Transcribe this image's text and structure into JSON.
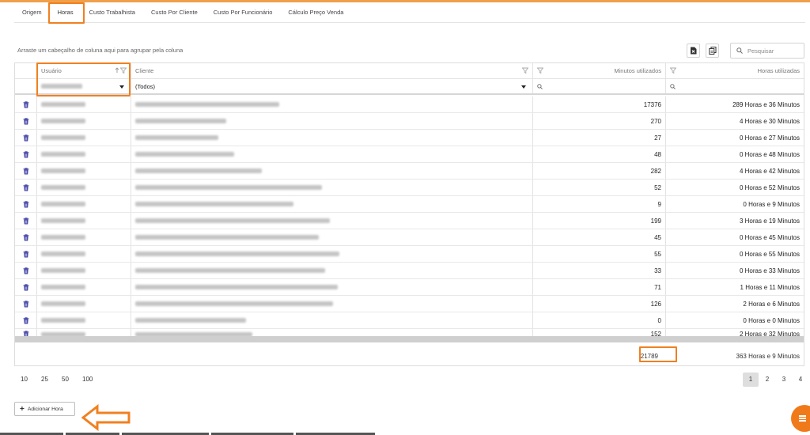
{
  "tabs": [
    {
      "label": "Origem"
    },
    {
      "label": "Horas",
      "active": true
    },
    {
      "label": "Custo Trabalhista"
    },
    {
      "label": "Custo Por Cliente"
    },
    {
      "label": "Custo Por Funcionário"
    },
    {
      "label": "Cálculo Preço Venda"
    }
  ],
  "grid": {
    "group_hint": "Arraste um cabeçalho de coluna aqui para agrupar pela coluna",
    "search_placeholder": "Pesquisar",
    "columns": {
      "usuario": "Usuário",
      "cliente": "Cliente",
      "minutos": "Minutos utilizados",
      "horas": "Horas utilizadas"
    },
    "filters": {
      "cliente": "(Todos)"
    },
    "rows": [
      {
        "minutos": "17376",
        "horas": "289 Horas e 36 Minutos"
      },
      {
        "minutos": "270",
        "horas": "4 Horas e 30 Minutos"
      },
      {
        "minutos": "27",
        "horas": "0 Horas e 27 Minutos"
      },
      {
        "minutos": "48",
        "horas": "0 Horas e 48 Minutos"
      },
      {
        "minutos": "282",
        "horas": "4 Horas e 42 Minutos"
      },
      {
        "minutos": "52",
        "horas": "0 Horas e 52 Minutos"
      },
      {
        "minutos": "9",
        "horas": "0 Horas e 9 Minutos"
      },
      {
        "minutos": "199",
        "horas": "3 Horas e 19 Minutos"
      },
      {
        "minutos": "45",
        "horas": "0 Horas e 45 Minutos"
      },
      {
        "minutos": "55",
        "horas": "0 Horas e 55 Minutos"
      },
      {
        "minutos": "33",
        "horas": "0 Horas e 33 Minutos"
      },
      {
        "minutos": "71",
        "horas": "1 Horas e 11 Minutos"
      },
      {
        "minutos": "126",
        "horas": "2 Horas e 6 Minutos"
      },
      {
        "minutos": "0",
        "horas": "0 Horas e 0 Minutos"
      },
      {
        "minutos": "152",
        "horas": "2 Horas e 32 Minutos"
      }
    ],
    "totals": {
      "minutos": "21789",
      "horas": "363 Horas e 9 Minutos"
    }
  },
  "pagination": {
    "page_sizes": [
      "10",
      "25",
      "50",
      "100"
    ],
    "pages": [
      "1",
      "2",
      "3",
      "4"
    ],
    "current_page": "1"
  },
  "actions": {
    "add_label": "Adicionar Hora"
  },
  "colors": {
    "accent": "#f08020",
    "fab": "#f07a1a",
    "delete_icon": "#3b3ba0"
  }
}
